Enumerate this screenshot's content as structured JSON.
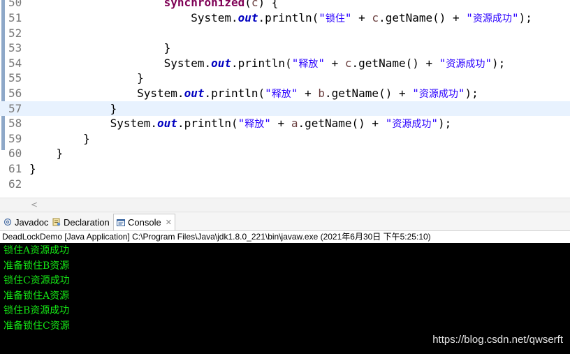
{
  "editor": {
    "lines": [
      {
        "num": "50",
        "parts": [
          {
            "t": "                    "
          },
          {
            "t": "synchronized",
            "c": "kw"
          },
          {
            "t": "("
          },
          {
            "t": "c",
            "c": "var"
          },
          {
            "t": ") {"
          }
        ]
      },
      {
        "num": "51",
        "parts": [
          {
            "t": "                        System."
          },
          {
            "t": "out",
            "c": "fld"
          },
          {
            "t": ".println("
          },
          {
            "t": "\"锁住\"",
            "c": "str"
          },
          {
            "t": " + "
          },
          {
            "t": "c",
            "c": "var"
          },
          {
            "t": ".getName() + "
          },
          {
            "t": "\"资源成功\"",
            "c": "str"
          },
          {
            "t": ");"
          }
        ]
      },
      {
        "num": "52",
        "parts": []
      },
      {
        "num": "53",
        "parts": [
          {
            "t": "                    }"
          }
        ]
      },
      {
        "num": "54",
        "parts": [
          {
            "t": "                    System."
          },
          {
            "t": "out",
            "c": "fld"
          },
          {
            "t": ".println("
          },
          {
            "t": "\"释放\"",
            "c": "str"
          },
          {
            "t": " + "
          },
          {
            "t": "c",
            "c": "var"
          },
          {
            "t": ".getName() + "
          },
          {
            "t": "\"资源成功\"",
            "c": "str"
          },
          {
            "t": ");"
          }
        ]
      },
      {
        "num": "55",
        "parts": [
          {
            "t": "                }"
          }
        ]
      },
      {
        "num": "56",
        "parts": [
          {
            "t": "                System."
          },
          {
            "t": "out",
            "c": "fld"
          },
          {
            "t": ".println("
          },
          {
            "t": "\"释放\"",
            "c": "str"
          },
          {
            "t": " + "
          },
          {
            "t": "b",
            "c": "var"
          },
          {
            "t": ".getName() + "
          },
          {
            "t": "\"资源成功\"",
            "c": "str"
          },
          {
            "t": ");"
          }
        ]
      },
      {
        "num": "57",
        "active": true,
        "parts": [
          {
            "t": "            }"
          }
        ]
      },
      {
        "num": "58",
        "parts": [
          {
            "t": "            System."
          },
          {
            "t": "out",
            "c": "fld"
          },
          {
            "t": ".println("
          },
          {
            "t": "\"释放\"",
            "c": "str"
          },
          {
            "t": " + "
          },
          {
            "t": "a",
            "c": "var"
          },
          {
            "t": ".getName() + "
          },
          {
            "t": "\"资源成功\"",
            "c": "str"
          },
          {
            "t": ");"
          }
        ]
      },
      {
        "num": "59",
        "parts": [
          {
            "t": "        }"
          }
        ]
      },
      {
        "num": "60",
        "parts": [
          {
            "t": "    }"
          }
        ]
      },
      {
        "num": "61",
        "parts": [
          {
            "t": "}"
          }
        ]
      },
      {
        "num": "62",
        "parts": []
      }
    ],
    "scroll_left_glyph": "<"
  },
  "tabs": [
    {
      "label": "Javadoc",
      "icon": "at-icon"
    },
    {
      "label": "Declaration",
      "icon": "declaration-icon"
    },
    {
      "label": "Console",
      "icon": "console-icon",
      "active": true
    }
  ],
  "close_glyph": "✕",
  "console": {
    "header": "DeadLockDemo [Java Application] C:\\Program Files\\Java\\jdk1.8.0_221\\bin\\javaw.exe (2021年6月30日 下午5:25:10)",
    "output": [
      "锁住A资源成功",
      "准备锁住B资源",
      "锁住C资源成功",
      "准备锁住A资源",
      "锁住B资源成功",
      "准备锁住C资源"
    ],
    "text_color": "#15e615"
  },
  "watermark": "https://blog.csdn.net/qwserft"
}
